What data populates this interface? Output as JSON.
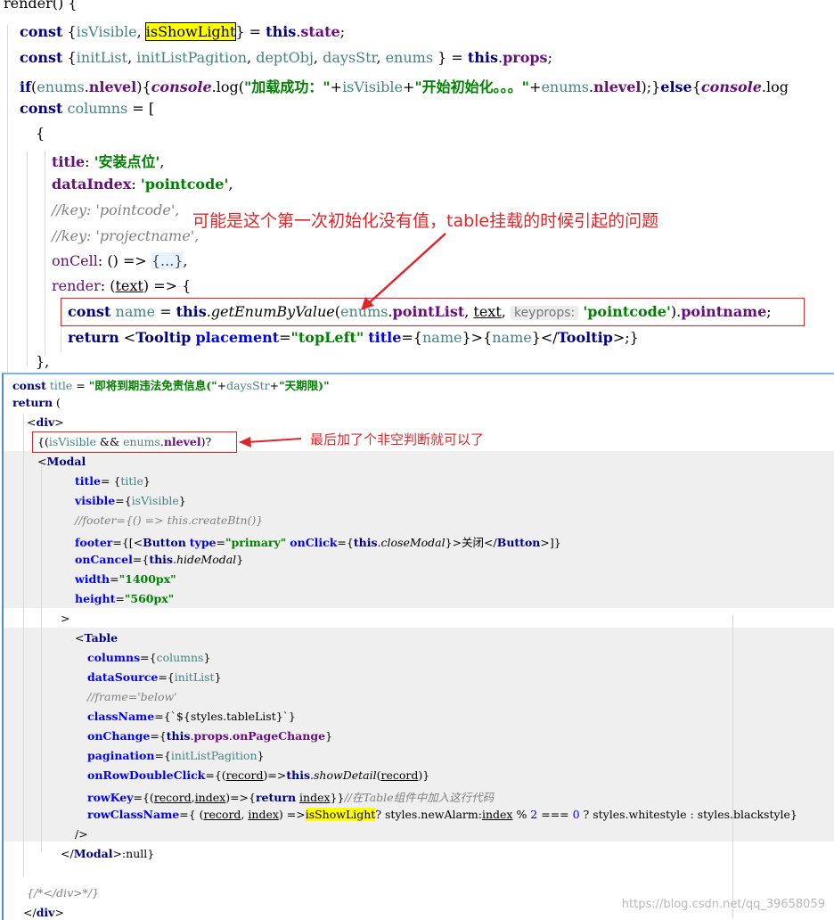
{
  "top": {
    "lines": [
      "render() {",
      "const {isVisible, isShowLight} = this.state;",
      "const {initList, initListPagition, deptObj, daysStr, enums } = this.props;",
      "if(enums.nlevel){console.log(\"加载成功：\"+isVisible+\"开始初始化。。。\"+enums.nlevel);}else{console.log",
      "const columns = [",
      "{",
      "title: '安装点位',",
      "dataIndex: 'pointcode',",
      "//key: 'pointcode',",
      "//key: 'projectname',",
      "onCell: () => {...},",
      "render: (text) => {",
      "const name = this.getEnumByValue(enums.pointList, text, keyprops: 'pointcode').pointname;",
      "return <Tooltip placement=\"topLeft\" title={name}>{name}</Tooltip>;}",
      "},"
    ],
    "highlight": "isShowLight",
    "hint": "keyprops:",
    "annotation": "可能是这个第一次初始化没有值，table挂载的时候引起的问题"
  },
  "bottom": {
    "lines": [
      "const title = \"即将到期违法免责信息(\"+daysStr+\"天期限)\"",
      "return (",
      "<div>",
      "{(isVisible && enums.nlevel)?",
      "<Modal",
      "title= {title}",
      "visible={isVisible}",
      "//footer={() => this.createBtn()}",
      "footer={[<Button type=\"primary\" onClick={this.closeModal}>关闭</Button>]}",
      "onCancel={this.hideModal}",
      "width=\"1400px\"",
      "height=\"560px\"",
      ">",
      "<Table",
      "columns={columns}",
      "dataSource={initList}",
      "//frame='below'",
      "className={`${styles.tableList}`}",
      "onChange={this.props.onPageChange}",
      "pagination={initListPagition}",
      "onRowDoubleClick={(record)=>this.showDetail(record)}",
      "rowKey={(record,index)=>{return index}}//在Table组件中加入这行代码",
      "rowClassName={ (record, index) =>isShowLight? styles.newAlarm:index % 2 === 0 ? styles.whitestyle : styles.blackstyle}",
      "/>",
      "</Modal>:null}",
      "{/*</div>*/}",
      "</div>"
    ],
    "highlight": "isShowLight",
    "annotation": "最后加了个非空判断就可以了"
  },
  "watermark": "https://blog.csdn.net/qq_39658059",
  "colors": {
    "annotation": "#e0252a",
    "highlight": "#ffff00",
    "keyword": "#000080",
    "string": "#008000"
  }
}
